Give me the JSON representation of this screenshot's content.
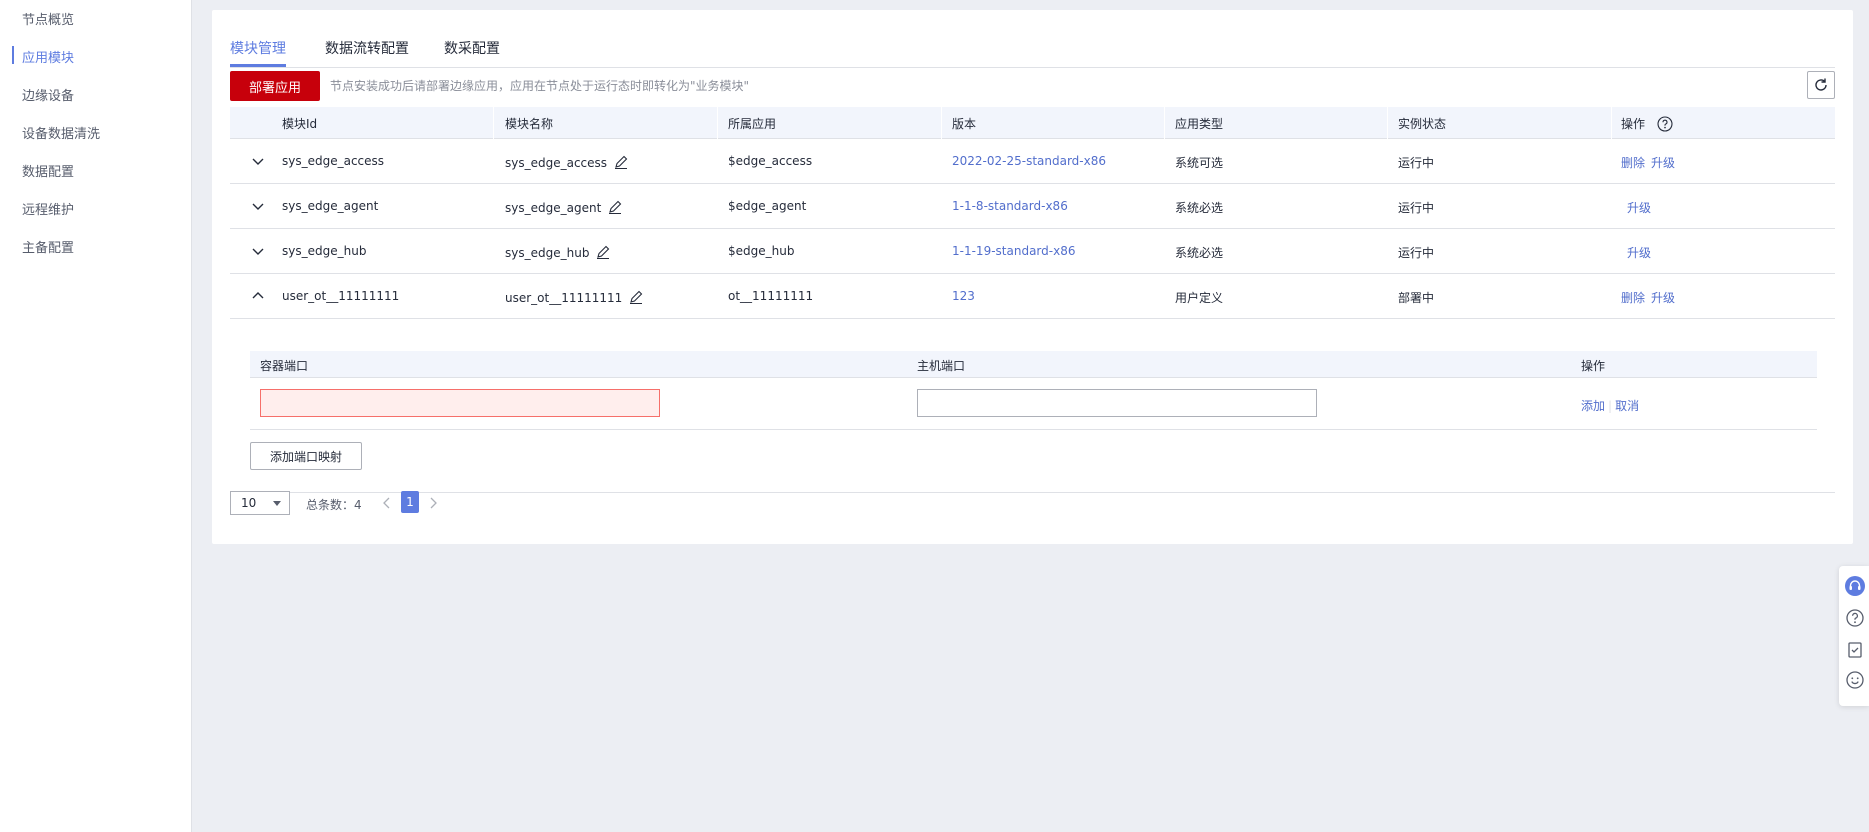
{
  "sidebar": {
    "items": [
      {
        "label": "节点概览"
      },
      {
        "label": "应用模块",
        "active": true
      },
      {
        "label": "边缘设备"
      },
      {
        "label": "设备数据清洗"
      },
      {
        "label": "数据配置"
      },
      {
        "label": "远程维护"
      },
      {
        "label": "主备配置"
      }
    ]
  },
  "tabs": [
    {
      "label": "模块管理",
      "active": true
    },
    {
      "label": "数据流转配置"
    },
    {
      "label": "数采配置"
    }
  ],
  "toolbar": {
    "deploy_label": "部署应用",
    "hint": "节点安装成功后请部署边缘应用，应用在节点处于运行态时即转化为\"业务模块\""
  },
  "table": {
    "columns": [
      "模块Id",
      "模块名称",
      "所属应用",
      "版本",
      "应用类型",
      "实例状态",
      "操作"
    ],
    "rows": [
      {
        "id": "sys_edge_access",
        "name": "sys_edge_access",
        "app": "$edge_access",
        "version": "2022-02-25-standard-x86",
        "type": "系统可选",
        "status": "运行中",
        "ops": [
          "删除",
          "升级"
        ],
        "expanded": false
      },
      {
        "id": "sys_edge_agent",
        "name": "sys_edge_agent",
        "app": "$edge_agent",
        "version": "1-1-8-standard-x86",
        "type": "系统必选",
        "status": "运行中",
        "ops": [
          "升级"
        ],
        "expanded": false
      },
      {
        "id": "sys_edge_hub",
        "name": "sys_edge_hub",
        "app": "$edge_hub",
        "version": "1-1-19-standard-x86",
        "type": "系统必选",
        "status": "运行中",
        "ops": [
          "升级"
        ],
        "expanded": false
      },
      {
        "id": "user_ot__11111111",
        "name": "user_ot__11111111",
        "app": "ot__11111111",
        "version": "123",
        "type": "用户定义",
        "status": "部署中",
        "ops": [
          "删除",
          "升级"
        ],
        "expanded": true
      }
    ]
  },
  "port_mapping": {
    "columns": [
      "容器端口",
      "主机端口",
      "操作"
    ],
    "container_port": "",
    "host_port": "",
    "add_label": "添加",
    "cancel_label": "取消",
    "add_mapping_label": "添加端口映射"
  },
  "pagination": {
    "page_size": "10",
    "total_label": "总条数：4",
    "current_page": "1"
  },
  "colors": {
    "accent": "#5e7ce0",
    "link": "#526ecc",
    "primary_button": "#c7000b",
    "error_border": "#f66f6a"
  },
  "icons": [
    "chevron-down-icon",
    "chevron-up-icon",
    "edit-icon",
    "refresh-icon",
    "help-icon",
    "customer-service-icon",
    "feedback-icon",
    "smile-icon"
  ]
}
